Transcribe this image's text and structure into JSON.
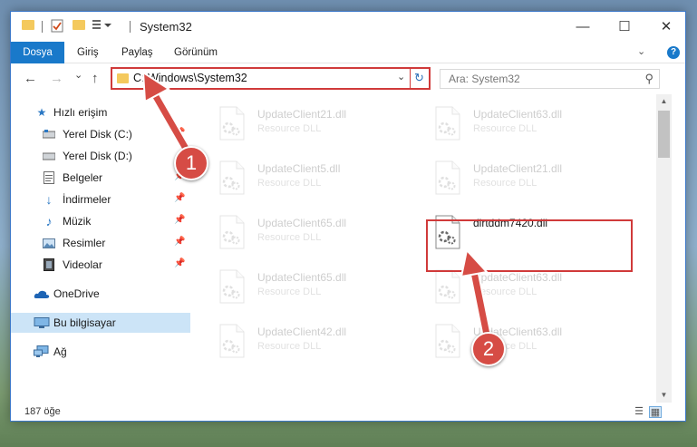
{
  "window": {
    "title": "System32",
    "controls": {
      "minimize": "—",
      "maximize": "☐",
      "close": "✕"
    }
  },
  "ribbon": {
    "tabs": [
      {
        "label": "Dosya"
      },
      {
        "label": "Giriş"
      },
      {
        "label": "Paylaş"
      },
      {
        "label": "Görünüm"
      }
    ],
    "expand": "⌄",
    "help": "?"
  },
  "nav": {
    "back": "←",
    "forward": "→",
    "recent": "⌄",
    "up": "↑",
    "address": "C:\\Windows\\System32",
    "address_dropdown": "⌄",
    "refresh": "↻",
    "search_placeholder": "Ara: System32"
  },
  "sidebar": {
    "items": [
      {
        "label": "Hızlı erişim",
        "icon": "star-icon",
        "pinned": false
      },
      {
        "label": "Yerel Disk (C:)",
        "icon": "drive-icon",
        "pinned": true
      },
      {
        "label": "Yerel Disk (D:)",
        "icon": "drive-icon",
        "pinned": false
      },
      {
        "label": "Belgeler",
        "icon": "documents-icon",
        "pinned": true
      },
      {
        "label": "İndirmeler",
        "icon": "download-icon",
        "pinned": true
      },
      {
        "label": "Müzik",
        "icon": "music-icon",
        "pinned": true
      },
      {
        "label": "Resimler",
        "icon": "pictures-icon",
        "pinned": true
      },
      {
        "label": "Videolar",
        "icon": "videos-icon",
        "pinned": true
      },
      {
        "label": "OneDrive",
        "icon": "cloud-icon",
        "pinned": false
      },
      {
        "label": "Bu bilgisayar",
        "icon": "computer-icon",
        "pinned": false,
        "selected": true
      },
      {
        "label": "Ağ",
        "icon": "network-icon",
        "pinned": false
      }
    ],
    "pin_glyph": "📌"
  },
  "files": [
    {
      "name": "UpdateClient21.dll",
      "desc": "Resource DLL",
      "faded": true
    },
    {
      "name": "UpdateClient63.dll",
      "desc": "Resource DLL",
      "faded": true
    },
    {
      "name": "UpdateClient5.dll",
      "desc": "Resource DLL",
      "faded": true
    },
    {
      "name": "UpdateClient21.dll",
      "desc": "Resource DLL",
      "faded": true
    },
    {
      "name": "UpdateClient65.dll",
      "desc": "Resource DLL",
      "faded": true
    },
    {
      "name": "dirtddm7420.dll",
      "desc": "",
      "faded": false
    },
    {
      "name": "UpdateClient65.dll",
      "desc": "Resource DLL",
      "faded": true
    },
    {
      "name": "UpdateClient63.dll",
      "desc": "Resource DLL",
      "faded": true
    },
    {
      "name": "UpdateClient42.dll",
      "desc": "Resource DLL",
      "faded": true
    },
    {
      "name": "UpdateClient63.dll",
      "desc": "Resource DLL",
      "faded": true
    }
  ],
  "status": {
    "count": "187 öğe"
  },
  "annotations": [
    {
      "number": "1"
    },
    {
      "number": "2"
    }
  ],
  "colors": {
    "accent": "#1979ca",
    "highlight": "#d03a3a",
    "badge": "#d64c45",
    "folder": "#f4c95d",
    "selected": "#cce4f7"
  }
}
